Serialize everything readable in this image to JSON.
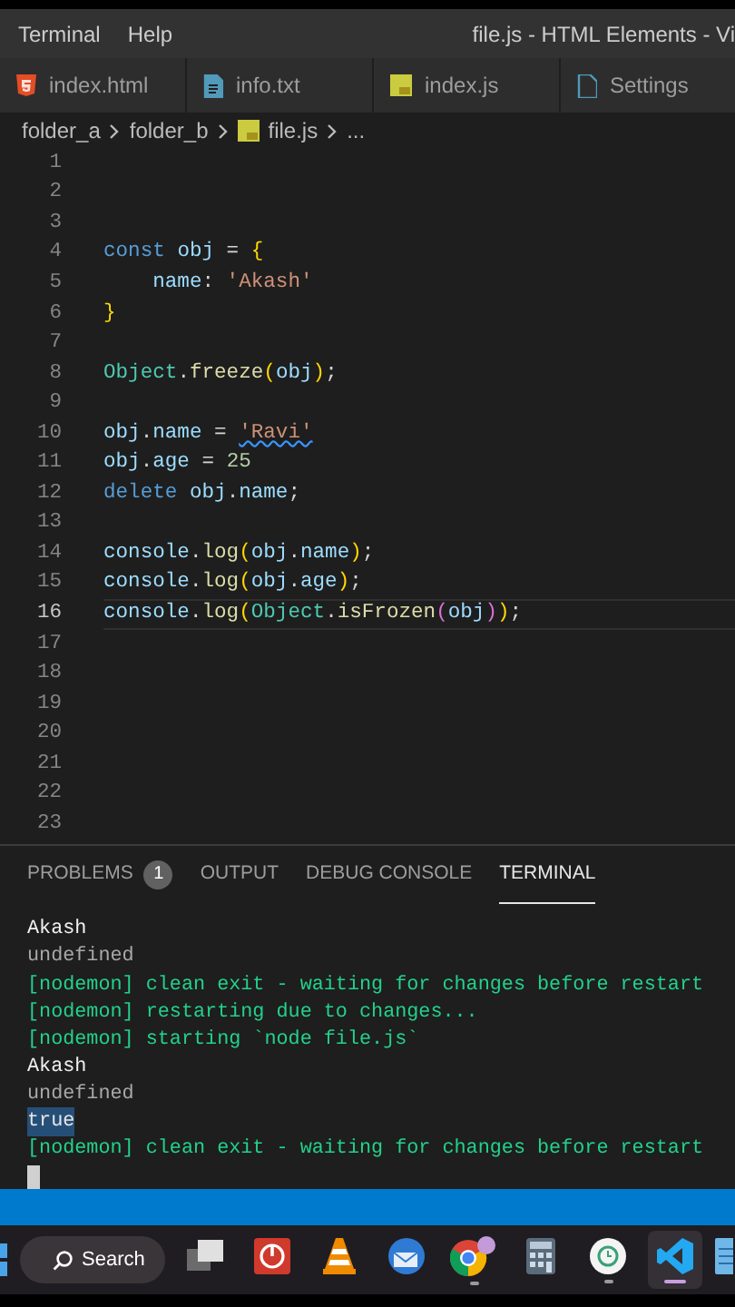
{
  "menu": {
    "items": [
      "Terminal",
      "Help"
    ],
    "title": "file.js - HTML Elements - Vi"
  },
  "tabs": [
    {
      "label": "index.html",
      "kind": "html",
      "selected": false
    },
    {
      "label": "info.txt",
      "kind": "text",
      "selected": false
    },
    {
      "label": "index.js",
      "kind": "js",
      "selected": false
    },
    {
      "label": "Settings",
      "kind": "settings",
      "selected": false
    }
  ],
  "breadcrumb": [
    {
      "label": "folder_a",
      "kind": "folder"
    },
    {
      "label": "folder_b",
      "kind": "folder"
    },
    {
      "label": "file.js",
      "kind": "js"
    },
    {
      "label": "...",
      "kind": "more"
    }
  ],
  "editor": {
    "lines": [
      {
        "number": "1",
        "current": false
      },
      {
        "number": "2",
        "current": false
      },
      {
        "number": "3",
        "current": false
      },
      {
        "number": "4",
        "current": false,
        "tokens": [
          {
            "text": "const ",
            "kind": "keyword"
          },
          {
            "text": "obj",
            "kind": "variable"
          },
          {
            "text": " = ",
            "kind": "punct"
          },
          {
            "text": "{",
            "kind": "bracket"
          }
        ]
      },
      {
        "number": "5",
        "current": false,
        "tokens": [
          {
            "text": "    name",
            "kind": "variable"
          },
          {
            "text": ": ",
            "kind": "punct"
          },
          {
            "text": "'Akash'",
            "kind": "string"
          }
        ]
      },
      {
        "number": "6",
        "current": false,
        "tokens": [
          {
            "text": "}",
            "kind": "bracket"
          }
        ]
      },
      {
        "number": "7",
        "current": false
      },
      {
        "number": "8",
        "current": false,
        "tokens": [
          {
            "text": "Object",
            "kind": "class"
          },
          {
            "text": ".",
            "kind": "punct"
          },
          {
            "text": "freeze",
            "kind": "function"
          },
          {
            "text": "(",
            "kind": "bracket"
          },
          {
            "text": "obj",
            "kind": "variable"
          },
          {
            "text": ")",
            "kind": "bracket"
          },
          {
            "text": ";",
            "kind": "punct"
          }
        ]
      },
      {
        "number": "9",
        "current": false
      },
      {
        "number": "10",
        "current": false,
        "tokens": [
          {
            "text": "obj",
            "kind": "variable"
          },
          {
            "text": ".",
            "kind": "punct"
          },
          {
            "text": "name",
            "kind": "variable"
          },
          {
            "text": " = ",
            "kind": "punct"
          },
          {
            "text": "'Ravi'",
            "kind": "flagged"
          }
        ]
      },
      {
        "number": "11",
        "current": false,
        "tokens": [
          {
            "text": "obj",
            "kind": "variable"
          },
          {
            "text": ".",
            "kind": "punct"
          },
          {
            "text": "age",
            "kind": "variable"
          },
          {
            "text": " = ",
            "kind": "punct"
          },
          {
            "text": "25",
            "kind": "number"
          }
        ]
      },
      {
        "number": "12",
        "current": false,
        "tokens": [
          {
            "text": "delete ",
            "kind": "keyword"
          },
          {
            "text": "obj",
            "kind": "variable"
          },
          {
            "text": ".",
            "kind": "punct"
          },
          {
            "text": "name",
            "kind": "variable"
          },
          {
            "text": ";",
            "kind": "punct"
          }
        ]
      },
      {
        "number": "13",
        "current": false
      },
      {
        "number": "14",
        "current": false,
        "tokens": [
          {
            "text": "console",
            "kind": "variable"
          },
          {
            "text": ".",
            "kind": "punct"
          },
          {
            "text": "log",
            "kind": "function"
          },
          {
            "text": "(",
            "kind": "bracket"
          },
          {
            "text": "obj",
            "kind": "variable"
          },
          {
            "text": ".",
            "kind": "punct"
          },
          {
            "text": "name",
            "kind": "variable"
          },
          {
            "text": ")",
            "kind": "bracket"
          },
          {
            "text": ";",
            "kind": "punct"
          }
        ]
      },
      {
        "number": "15",
        "current": false,
        "tokens": [
          {
            "text": "console",
            "kind": "variable"
          },
          {
            "text": ".",
            "kind": "punct"
          },
          {
            "text": "log",
            "kind": "function"
          },
          {
            "text": "(",
            "kind": "bracket"
          },
          {
            "text": "obj",
            "kind": "variable"
          },
          {
            "text": ".",
            "kind": "punct"
          },
          {
            "text": "age",
            "kind": "variable"
          },
          {
            "text": ")",
            "kind": "bracket"
          },
          {
            "text": ";",
            "kind": "punct"
          }
        ]
      },
      {
        "number": "16",
        "current": true,
        "tokens": [
          {
            "text": "console",
            "kind": "variable"
          },
          {
            "text": ".",
            "kind": "punct"
          },
          {
            "text": "log",
            "kind": "function"
          },
          {
            "text": "(",
            "kind": "bracket"
          },
          {
            "text": "Object",
            "kind": "class"
          },
          {
            "text": ".",
            "kind": "punct"
          },
          {
            "text": "isFrozen",
            "kind": "function"
          },
          {
            "text": "(",
            "kind": "bracket2"
          },
          {
            "text": "obj",
            "kind": "variable"
          },
          {
            "text": ")",
            "kind": "bracket2"
          },
          {
            "text": ")",
            "kind": "bracket"
          },
          {
            "text": ";",
            "kind": "punct"
          }
        ]
      },
      {
        "number": "17",
        "current": false
      },
      {
        "number": "18",
        "current": false
      },
      {
        "number": "19",
        "current": false
      },
      {
        "number": "20",
        "current": false
      },
      {
        "number": "21",
        "current": false
      },
      {
        "number": "22",
        "current": false
      },
      {
        "number": "23",
        "current": false
      }
    ]
  },
  "panel": {
    "tabs": [
      {
        "label": "PROBLEMS",
        "badge": "1",
        "selected": false
      },
      {
        "label": "OUTPUT",
        "selected": false
      },
      {
        "label": "DEBUG CONSOLE",
        "selected": false
      },
      {
        "label": "TERMINAL",
        "selected": true
      }
    ],
    "terminal": [
      {
        "text": "Akash",
        "kind": "output"
      },
      {
        "text": "undefined",
        "kind": "dim"
      },
      {
        "text": "[nodemon] clean exit - waiting for changes before restart",
        "kind": "nodemon"
      },
      {
        "text": "[nodemon] restarting due to changes...",
        "kind": "nodemon"
      },
      {
        "text": "[nodemon] starting `node file.js`",
        "kind": "nodemon"
      },
      {
        "text": "Akash",
        "kind": "output"
      },
      {
        "text": "undefined",
        "kind": "dim"
      },
      {
        "text": "true",
        "kind": "highlight"
      },
      {
        "text": "[nodemon] clean exit - waiting for changes before restart",
        "kind": "nodemon"
      }
    ]
  },
  "taskbar": {
    "search": "Search",
    "apps": [
      {
        "kind": "task-view",
        "running": false,
        "selected": false
      },
      {
        "kind": "power",
        "running": false,
        "selected": false
      },
      {
        "kind": "cone",
        "running": false,
        "selected": false
      },
      {
        "kind": "mail",
        "running": false,
        "selected": false
      },
      {
        "kind": "browser",
        "running": true,
        "selected": false
      },
      {
        "kind": "calculator",
        "running": false,
        "selected": false
      },
      {
        "kind": "clock",
        "running": true,
        "selected": false
      },
      {
        "kind": "code",
        "running": true,
        "selected": true
      },
      {
        "kind": "notepad",
        "running": false,
        "selected": false
      }
    ]
  }
}
